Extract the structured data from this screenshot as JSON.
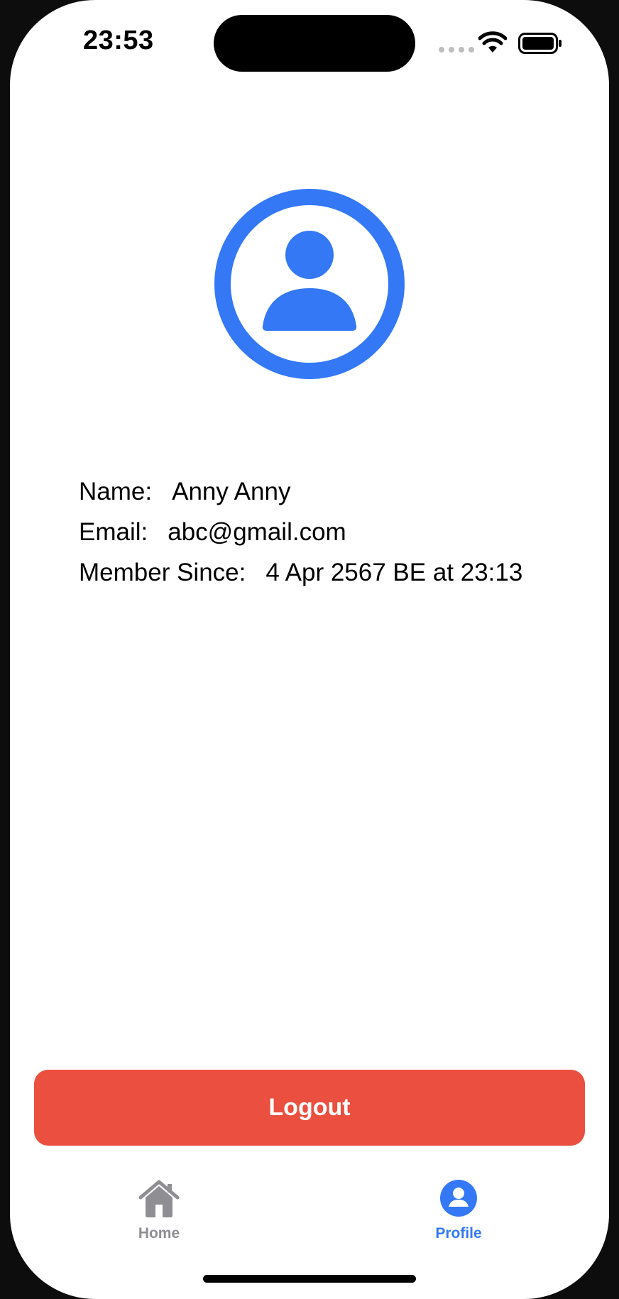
{
  "status_bar": {
    "time": "23:53"
  },
  "profile": {
    "name_label": "Name:",
    "name_value": "Anny Anny",
    "email_label": "Email:",
    "email_value": "abc@gmail.com",
    "member_since_label": "Member Since:",
    "member_since_value": "4 Apr 2567 BE at 23:13"
  },
  "actions": {
    "logout_label": "Logout"
  },
  "tab_bar": {
    "tabs": [
      {
        "label": "Home",
        "icon": "house-icon",
        "selected": false
      },
      {
        "label": "Profile",
        "icon": "person-circle-icon",
        "selected": true
      }
    ]
  },
  "colors": {
    "accent": "#3478f6",
    "logout": "#ea4f3f",
    "inactive_tab": "#8e8e93"
  }
}
